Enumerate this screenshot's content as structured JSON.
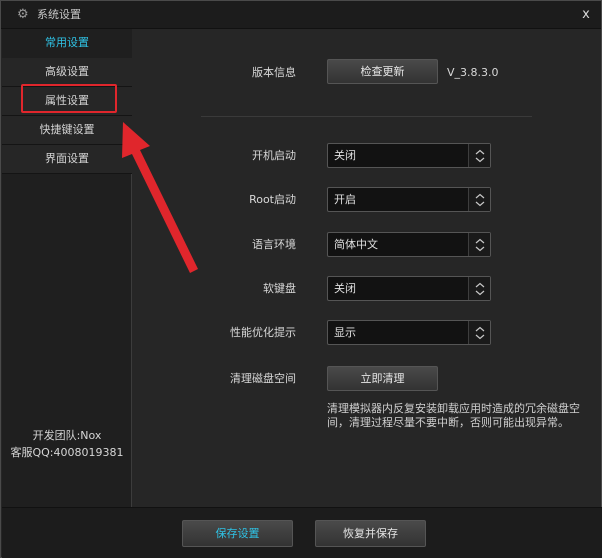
{
  "window": {
    "title": "系统设置",
    "title_icon": "gear-icon",
    "close_glyph": "x"
  },
  "sidebar": {
    "items": [
      {
        "label": "常用设置",
        "active": true
      },
      {
        "label": "高级设置",
        "active": false
      },
      {
        "label": "属性设置",
        "active": false
      },
      {
        "label": "快捷键设置",
        "active": false
      },
      {
        "label": "界面设置",
        "active": false
      }
    ],
    "team": "开发团队:Nox",
    "support": "客服QQ:4008019381"
  },
  "main": {
    "version": {
      "label": "版本信息",
      "button": "检查更新",
      "value": "V_3.8.3.0"
    },
    "settings": [
      {
        "label": "开机启动",
        "value": "关闭"
      },
      {
        "label": "Root启动",
        "value": "开启"
      },
      {
        "label": "语言环境",
        "value": "简体中文"
      },
      {
        "label": "软键盘",
        "value": "关闭"
      },
      {
        "label": "性能优化提示",
        "value": "显示"
      }
    ],
    "clean": {
      "label": "清理磁盘空间",
      "button": "立即清理",
      "description": "清理模拟器内反复安装卸载应用时造成的冗余磁盘空间，清理过程尽量不要中断，否则可能出现异常。"
    }
  },
  "footer": {
    "save": "保存设置",
    "restore": "恢复并保存"
  },
  "annotation": {
    "color": "#e0262c"
  },
  "colors": {
    "accent": "#2fc3e6",
    "background": "#262626"
  }
}
